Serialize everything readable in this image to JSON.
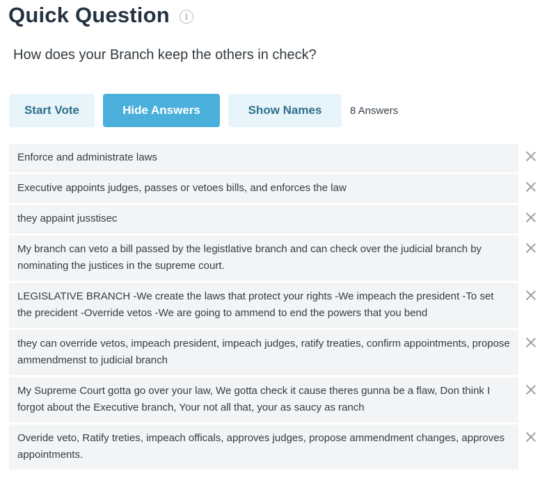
{
  "header": {
    "title": "Quick Question",
    "info_icon_glyph": "i"
  },
  "question": "How does your Branch keep the others in check?",
  "toolbar": {
    "start_vote_label": "Start Vote",
    "hide_answers_label": "Hide Answers",
    "show_names_label": "Show Names",
    "answers_count": "8 Answers"
  },
  "answers": [
    "Enforce and administrate laws",
    "Executive appoints judges, passes or vetoes bills, and enforces the law",
    "they appaint jusstisec",
    "My branch can veto a bill passed by the legistlative branch and can check over the judicial branch by nominating the justices in the supreme court.",
    "LEGISLATIVE BRANCH -We create the laws that protect your rights -We impeach the president -To set the precident -Override vetos -We are going to ammend to end the powers that you bend",
    "they can override vetos, impeach president, impeach judges, ratify treaties, confirm appointments, propose ammendmenst to judicial branch",
    "My Supreme Court gotta go over your law, We gotta check it cause theres gunna be a flaw, Don think I forgot about the Executive branch, Your not all that, your as saucy as ranch",
    "Overide veto, Ratify treties, impeach officals, approves judges, propose ammendment changes, approves appointments."
  ],
  "colors": {
    "primary": "#4aafda",
    "button_light": "#e7f5fb",
    "answer_bg": "#f3f4f5"
  },
  "icons": {
    "info": "info-icon",
    "remove": "close-icon"
  }
}
